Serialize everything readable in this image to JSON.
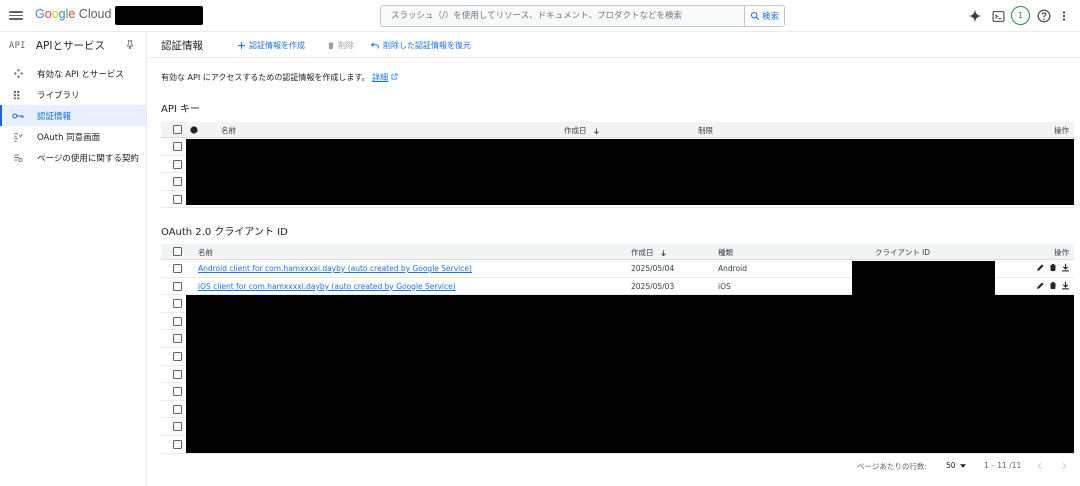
{
  "header": {
    "logo": {
      "g1": "G",
      "o1": "o",
      "o2": "o",
      "g2": "g",
      "l": "l",
      "e": "e",
      "cloud": " Cloud"
    },
    "search_placeholder": "スラッシュ（/）を使用してリソース、ドキュメント、プロダクトなどを検索",
    "search_button": "検索",
    "notifications_count": "1"
  },
  "sidebar": {
    "title": "APIとサービス",
    "api_mark": "API",
    "items": [
      {
        "label": "有効な API とサービス",
        "icon": "api-hub-icon"
      },
      {
        "label": "ライブラリ",
        "icon": "library-grid-icon"
      },
      {
        "label": "認証情報",
        "icon": "key-icon"
      },
      {
        "label": "OAuth 同意画面",
        "icon": "oauth-consent-icon"
      },
      {
        "label": "ページの使用に関する契約",
        "icon": "page-agreement-icon"
      }
    ],
    "active_index": 2
  },
  "toolbar": {
    "title": "認証情報",
    "create": "認証情報を作成",
    "delete": "削除",
    "restore": "削除した認証情報を復元"
  },
  "description": {
    "text": "有効な API にアクセスするための認証情報を作成します。",
    "link": "詳細"
  },
  "api_keys": {
    "title": "API キー",
    "columns": {
      "name": "名前",
      "created": "作成日",
      "restriction": "制限",
      "actions": "操作"
    },
    "row_count": 4
  },
  "oauth": {
    "title": "OAuth 2.0 クライアント ID",
    "columns": {
      "name": "名前",
      "created": "作成日",
      "type": "種類",
      "client_id": "クライアント ID",
      "actions": "操作"
    },
    "rows": [
      {
        "name": "Android client for com.hamxxxxi.dayby (auto created by Google Service)",
        "created": "2025/05/04",
        "type": "Android"
      },
      {
        "name": "iOS client for com.hamxxxxi.dayby (auto created by Google Service)",
        "created": "2025/05/03",
        "type": "iOS"
      }
    ],
    "redacted_row_count": 9
  },
  "footer": {
    "rows_per_page_label": "ページあたりの行数:",
    "rows_per_page": "50",
    "range": "1 – 11 /11"
  },
  "colors": {
    "accent": "#1a73e8",
    "active_bg": "#e8f0fe",
    "header_bg": "#f1f3f4"
  }
}
